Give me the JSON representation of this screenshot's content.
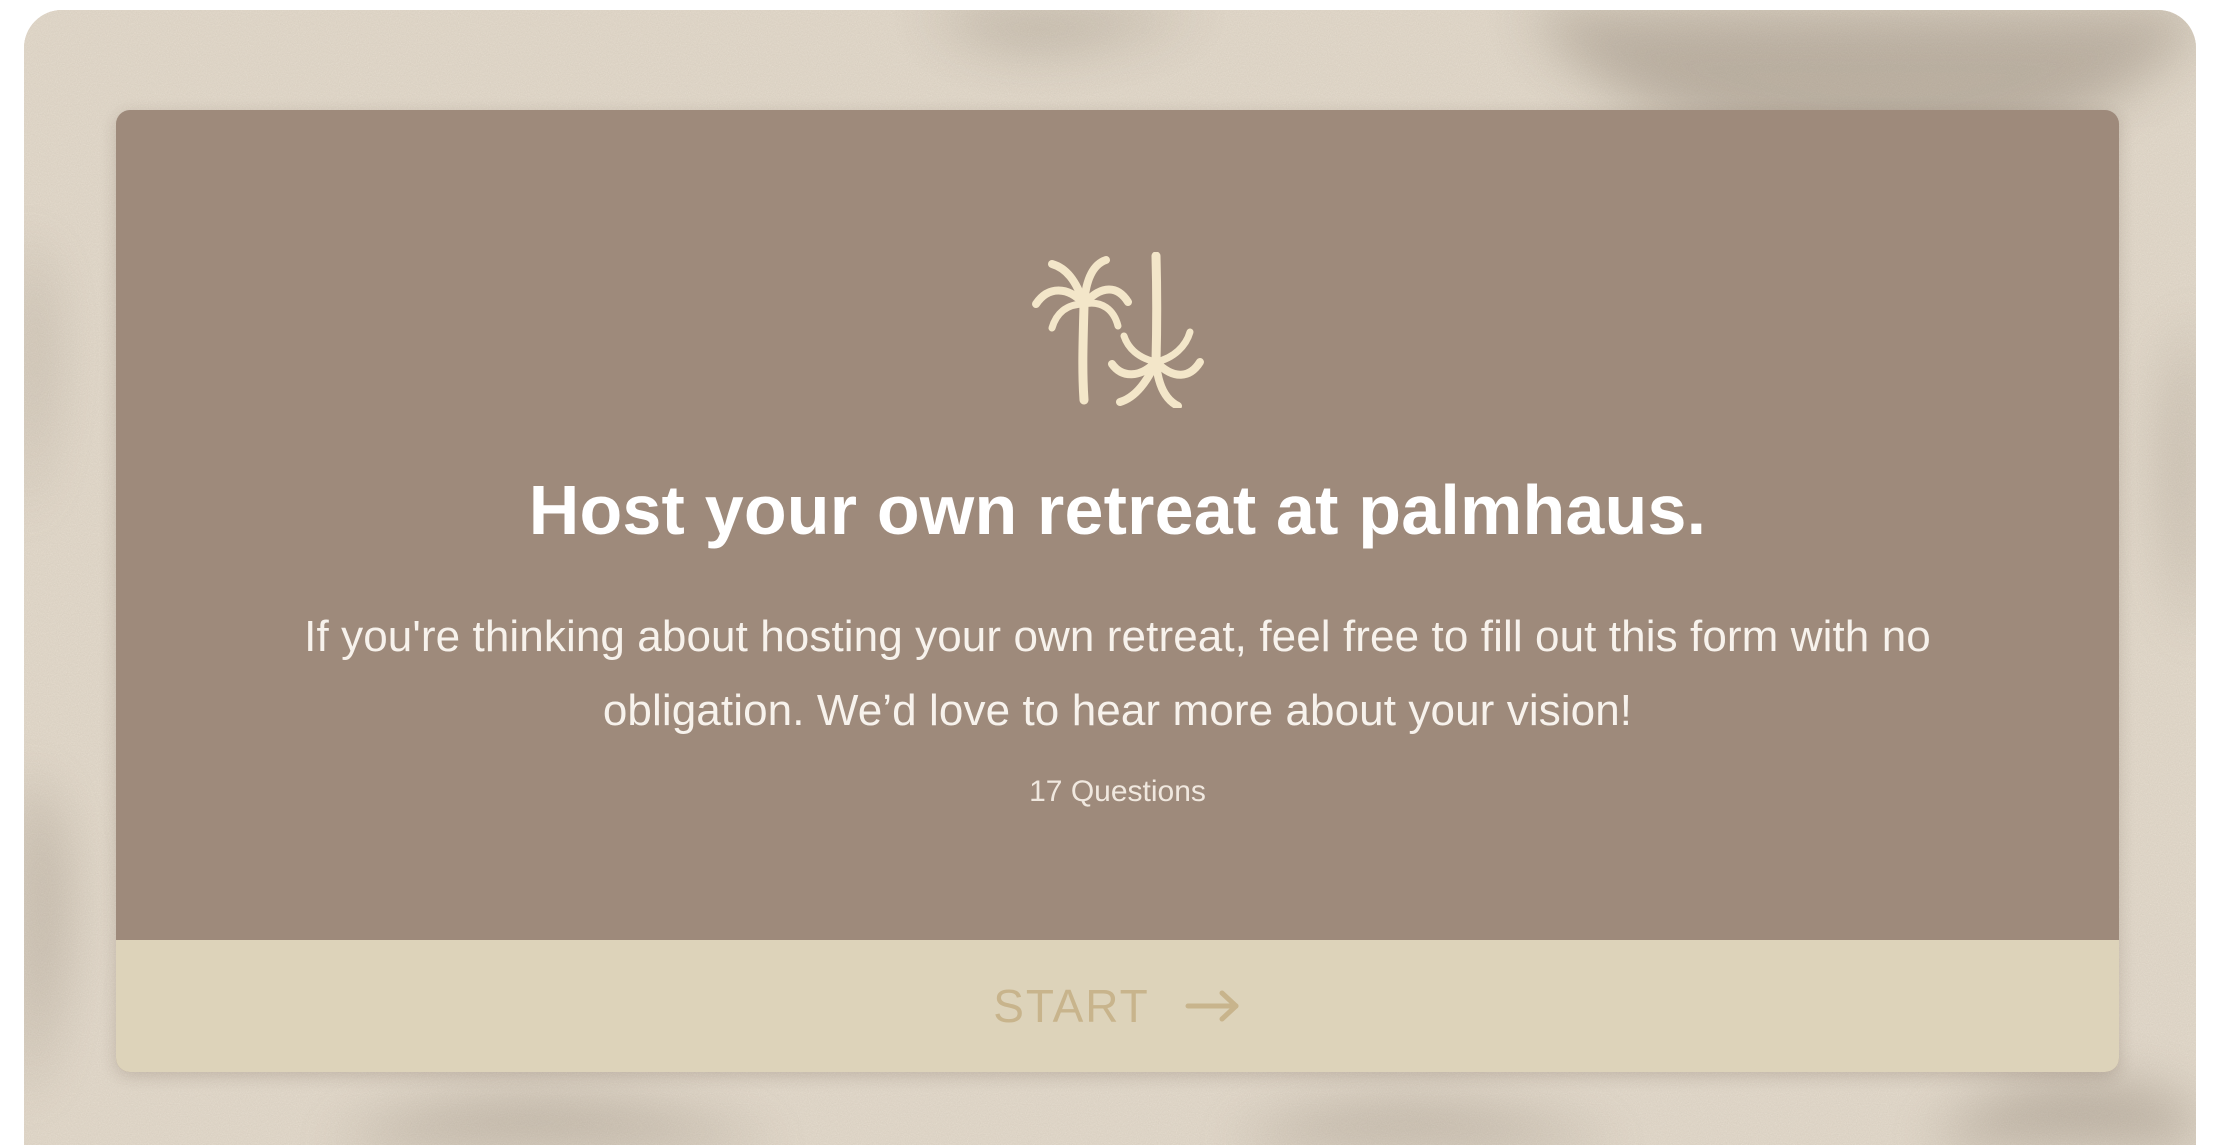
{
  "form": {
    "logo_icon": "palm-trees-icon",
    "title": "Host your own retreat at palmhaus.",
    "description": "If you're thinking about hosting your own retreat, feel free to fill out this form with no obligation. We’d love to hear more about your vision!",
    "question_count": "17 Questions",
    "start_label": "START",
    "start_icon": "arrow-right-icon"
  },
  "colors": {
    "card_background": "#9e8a7b",
    "start_bar_background": "#ddd3ba",
    "start_label": "#c8b48c",
    "logo": "#f3e6c9",
    "title_text": "#ffffff"
  }
}
